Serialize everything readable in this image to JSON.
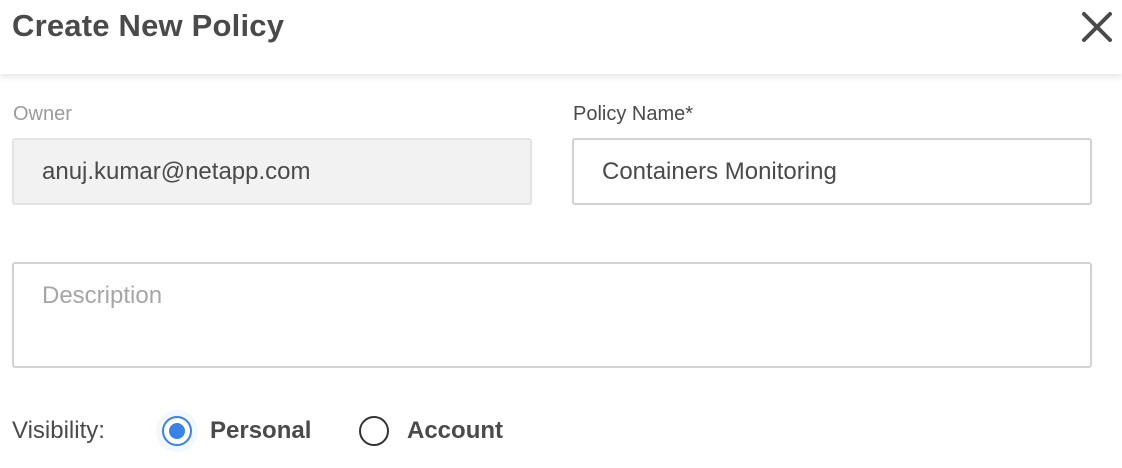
{
  "dialog": {
    "title": "Create New Policy",
    "close_icon": "close-icon"
  },
  "form": {
    "owner": {
      "label": "Owner",
      "value": "anuj.kumar@netapp.com"
    },
    "policy_name": {
      "label": "Policy Name*",
      "value": "Containers Monitoring"
    },
    "description": {
      "placeholder": "Description",
      "value": ""
    },
    "visibility": {
      "label": "Visibility:",
      "options": [
        {
          "label": "Personal",
          "selected": true
        },
        {
          "label": "Account",
          "selected": false
        }
      ]
    }
  },
  "colors": {
    "accent": "#3b82e6",
    "text": "#4a4a4a",
    "muted_label": "#9b9b9b",
    "border": "#d2d2d2",
    "readonly_bg": "#f2f2f2"
  }
}
